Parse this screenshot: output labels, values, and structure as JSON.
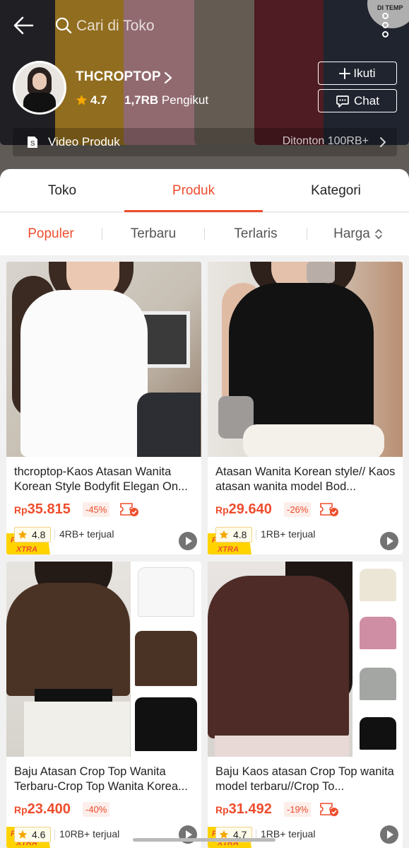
{
  "header": {
    "search_placeholder": "Cari di Toko",
    "shop_name": "THCROPTOP",
    "rating": "4.7",
    "followers_count": "1,7RB",
    "followers_label": "Pengikut",
    "follow_label": "Ikuti",
    "chat_label": "Chat",
    "video_label": "Video Produk",
    "video_views": "Ditonton 100RB+",
    "banner_text": "DI TEMP"
  },
  "tabs": [
    "Toko",
    "Produk",
    "Kategori"
  ],
  "active_tab": "Produk",
  "filters": [
    "Populer",
    "Terbaru",
    "Terlaris",
    "Harga"
  ],
  "active_filter": "Populer",
  "promo_badge": {
    "line1": "PROMO",
    "line2": "XTRA"
  },
  "colors": {
    "accent": "#ee4d2d",
    "star": "#f6a700",
    "promo_yellow": "#ffd300"
  },
  "products": [
    {
      "title": "thcroptop-Kaos Atasan Wanita Korean Style Bodyfit Elegan On...",
      "currency": "Rp",
      "price": "35.815",
      "discount": "-45%",
      "rating": "4.8",
      "sold": "4RB+ terjual"
    },
    {
      "title": "Atasan Wanita Korean style// Kaos atasan wanita model Bod...",
      "currency": "Rp",
      "price": "29.640",
      "discount": "-26%",
      "rating": "4.8",
      "sold": "1RB+ terjual"
    },
    {
      "title": "Baju Atasan Crop Top Wanita Terbaru-Crop Top Wanita Korea...",
      "currency": "Rp",
      "price": "23.400",
      "discount": "-40%",
      "rating": "4.6",
      "sold": "10RB+ terjual"
    },
    {
      "title": "Baju Kaos atasan Crop Top wanita model terbaru//Crop To...",
      "currency": "Rp",
      "price": "31.492",
      "discount": "-19%",
      "rating": "4.7",
      "sold": "1RB+ terjual"
    }
  ]
}
